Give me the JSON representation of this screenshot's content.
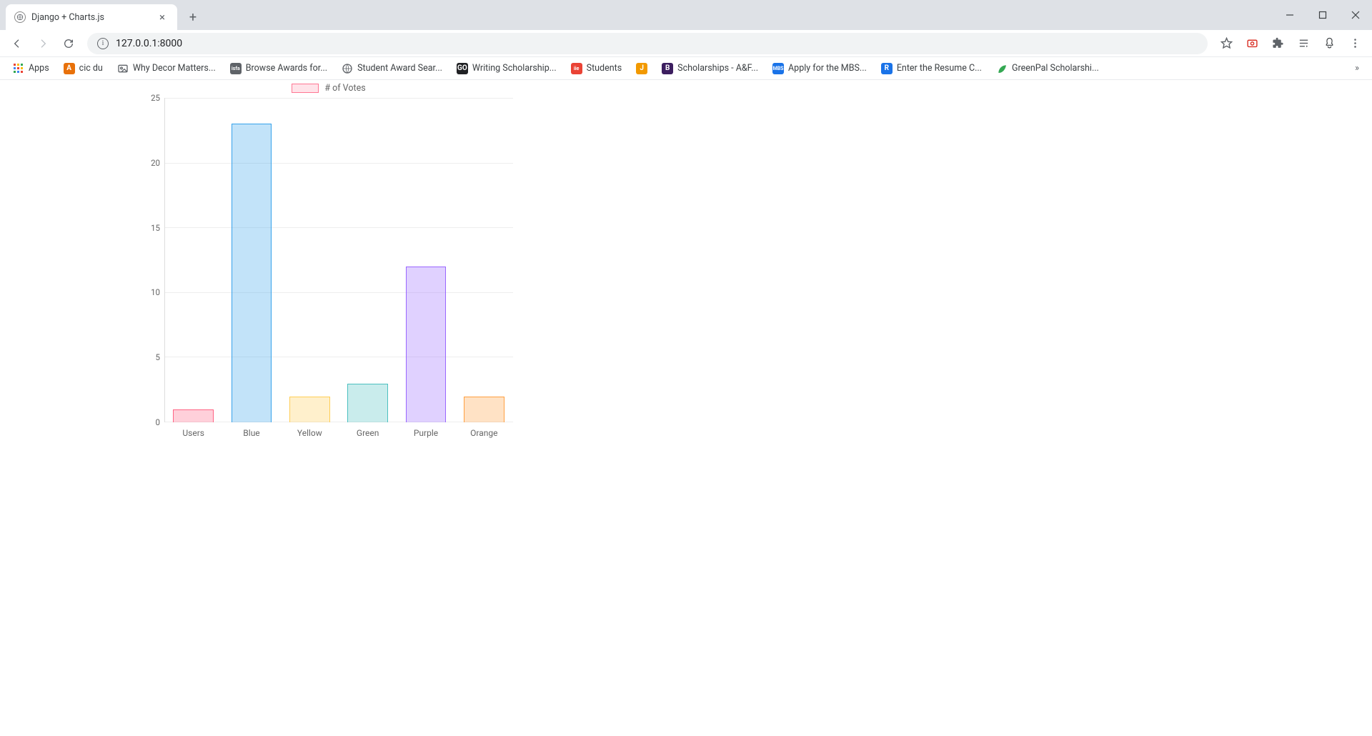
{
  "tab": {
    "title": "Django + Charts.js"
  },
  "url": "127.0.0.1:8000",
  "bookmarks": [
    {
      "label": "Apps",
      "icon": "grid",
      "color": ""
    },
    {
      "label": "cic du",
      "icon": "A",
      "color": "#e8710a"
    },
    {
      "label": "Why Decor Matters...",
      "icon": "img",
      "color": "#5f6368"
    },
    {
      "label": "Browse Awards for...",
      "icon": "isfa",
      "color": "#5f6368"
    },
    {
      "label": "Student Award Sear...",
      "icon": "globe",
      "color": "#5f6368"
    },
    {
      "label": "Writing Scholarship...",
      "icon": "GO",
      "color": "#202124"
    },
    {
      "label": "Students",
      "icon": "iie",
      "color": "#ea4335"
    },
    {
      "label": "",
      "icon": "J",
      "color": "#f29900"
    },
    {
      "label": "Scholarships - A&F...",
      "icon": "B",
      "color": "#3c1e5f"
    },
    {
      "label": "Apply for the MBS...",
      "icon": "MBS",
      "color": "#1a73e8"
    },
    {
      "label": "Enter the Resume C...",
      "icon": "R",
      "color": "#1a73e8"
    },
    {
      "label": "GreenPal Scholarshi...",
      "icon": "leaf",
      "color": "#34a853"
    }
  ],
  "chart_data": {
    "type": "bar",
    "legend_label": "# of Votes",
    "categories": [
      "Users",
      "Blue",
      "Yellow",
      "Green",
      "Purple",
      "Orange"
    ],
    "values": [
      1,
      23,
      2,
      3,
      12,
      2
    ],
    "y_ticks": [
      0,
      5,
      10,
      15,
      20,
      25
    ],
    "ylim": [
      0,
      25
    ],
    "bar_colors_fill": [
      "rgba(255,99,132,0.30)",
      "rgba(54,162,235,0.30)",
      "rgba(255,206,86,0.30)",
      "rgba(75,192,192,0.30)",
      "rgba(153,102,255,0.30)",
      "rgba(255,159,64,0.30)"
    ],
    "bar_colors_border": [
      "rgba(255,99,132,1)",
      "rgba(54,162,235,1)",
      "rgba(255,206,86,1)",
      "rgba(75,192,192,1)",
      "rgba(153,102,255,1)",
      "rgba(255,159,64,1)"
    ]
  }
}
